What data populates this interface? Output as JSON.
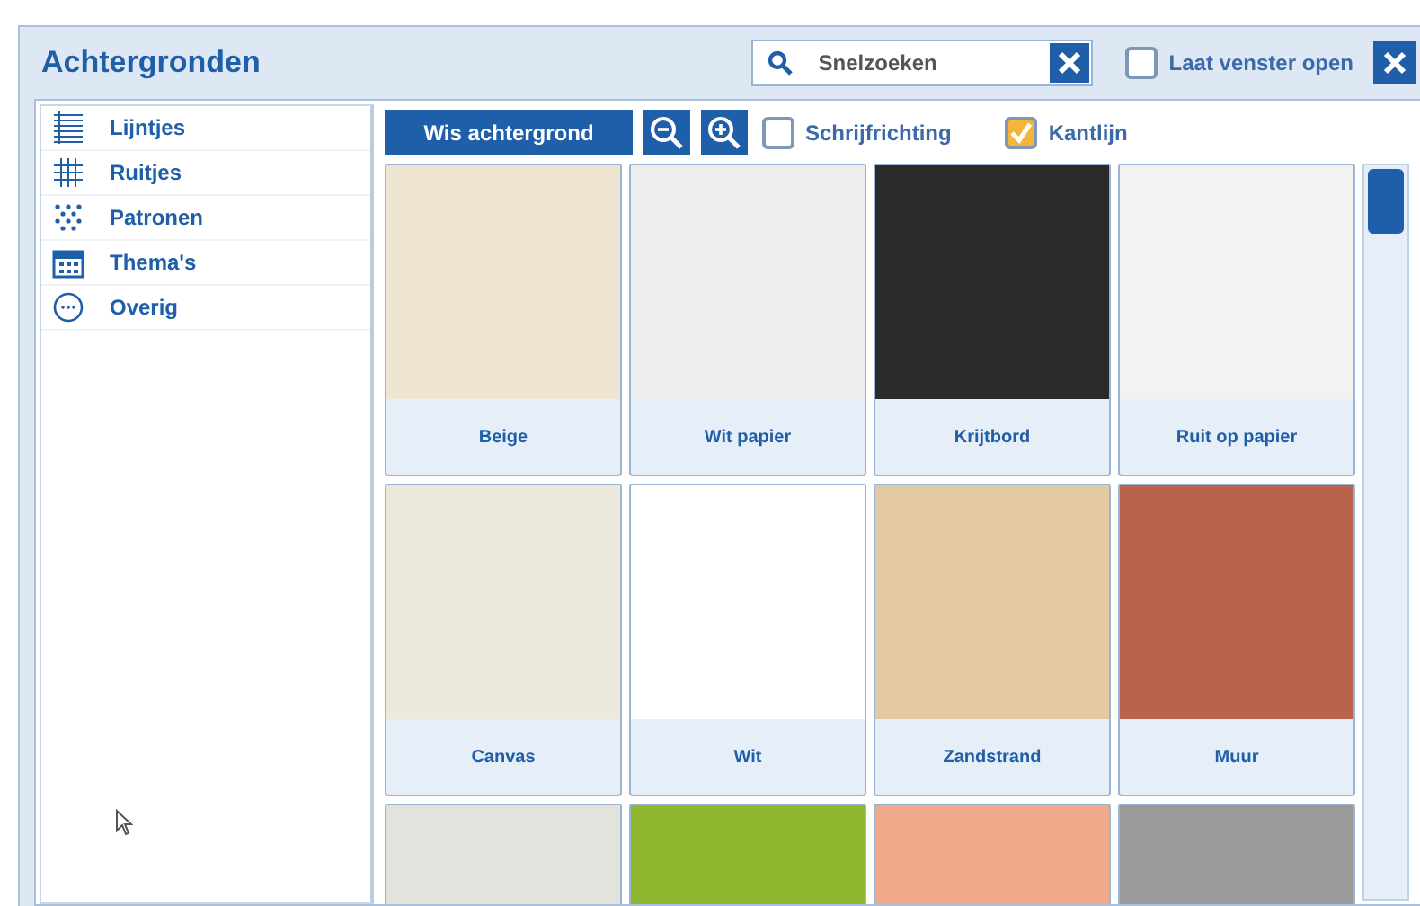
{
  "window": {
    "title": "Achtergronden"
  },
  "search": {
    "placeholder": "Snelzoeken"
  },
  "keep_open": {
    "label": "Laat venster open",
    "checked": false
  },
  "sidebar": {
    "items": [
      {
        "label": "Lijntjes",
        "kind": "lines"
      },
      {
        "label": "Ruitjes",
        "kind": "grid"
      },
      {
        "label": "Patronen",
        "kind": "dots"
      },
      {
        "label": "Thema's",
        "kind": "calendar"
      },
      {
        "label": "Overig",
        "kind": "more"
      }
    ]
  },
  "toolbar": {
    "clear_button": "Wis achtergrond",
    "options": [
      {
        "label": "Schrijfrichting",
        "checked": false
      },
      {
        "label": "Kantlijn",
        "checked": true
      }
    ]
  },
  "tiles": [
    {
      "label": "Beige",
      "color": "#eee5d2"
    },
    {
      "label": "Wit papier",
      "color": "#eeeeee"
    },
    {
      "label": "Krijtbord",
      "color": "#2a2a2a"
    },
    {
      "label": "Ruit op papier",
      "color": "#f2f2f2"
    },
    {
      "label": "Canvas",
      "color": "#ece8dc"
    },
    {
      "label": "Wit",
      "color": "#ffffff"
    },
    {
      "label": "Zandstrand",
      "color": "#e2c9a2"
    },
    {
      "label": "Muur",
      "color": "#b8644a"
    },
    {
      "color": "#e4e2dc"
    },
    {
      "color": "#8fb830"
    },
    {
      "color": "#f0a888"
    },
    {
      "color": "#9a9a9a"
    }
  ]
}
